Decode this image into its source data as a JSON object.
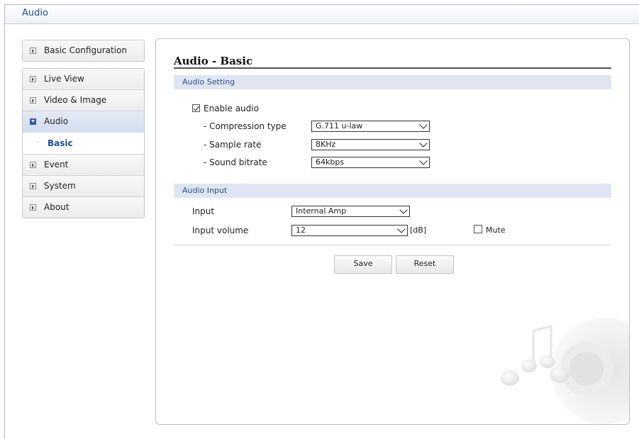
{
  "window": {
    "title": "Audio"
  },
  "sidebar": {
    "top": [
      {
        "label": "Basic Configuration"
      }
    ],
    "items": [
      {
        "label": "Live View"
      },
      {
        "label": "Video & Image"
      },
      {
        "label": "Audio",
        "active": true
      },
      {
        "label": "Event"
      },
      {
        "label": "System"
      },
      {
        "label": "About"
      }
    ],
    "sub": {
      "label": "Basic",
      "bullet": "·"
    }
  },
  "main": {
    "title": "Audio - Basic",
    "audio_setting": {
      "header": "Audio Setting",
      "enable_label": "Enable audio",
      "enable_checked": true,
      "compression": {
        "label": "- Compression type",
        "value": "G.711 u-law"
      },
      "sample_rate": {
        "label": "- Sample rate",
        "value": "8KHz"
      },
      "bitrate": {
        "label": "- Sound bitrate",
        "value": "64kbps"
      }
    },
    "audio_input": {
      "header": "Audio Input",
      "input": {
        "label": "Input",
        "value": "Internal Amp"
      },
      "volume": {
        "label": "Input volume",
        "value": "12",
        "unit": "[dB]"
      },
      "mute_label": "Mute",
      "mute_checked": false
    },
    "buttons": {
      "save": "Save",
      "reset": "Reset"
    }
  },
  "colors": {
    "accent": "#1f4e9a",
    "section_bg": "#dfe6f2",
    "active_nav": "#d4deef"
  }
}
